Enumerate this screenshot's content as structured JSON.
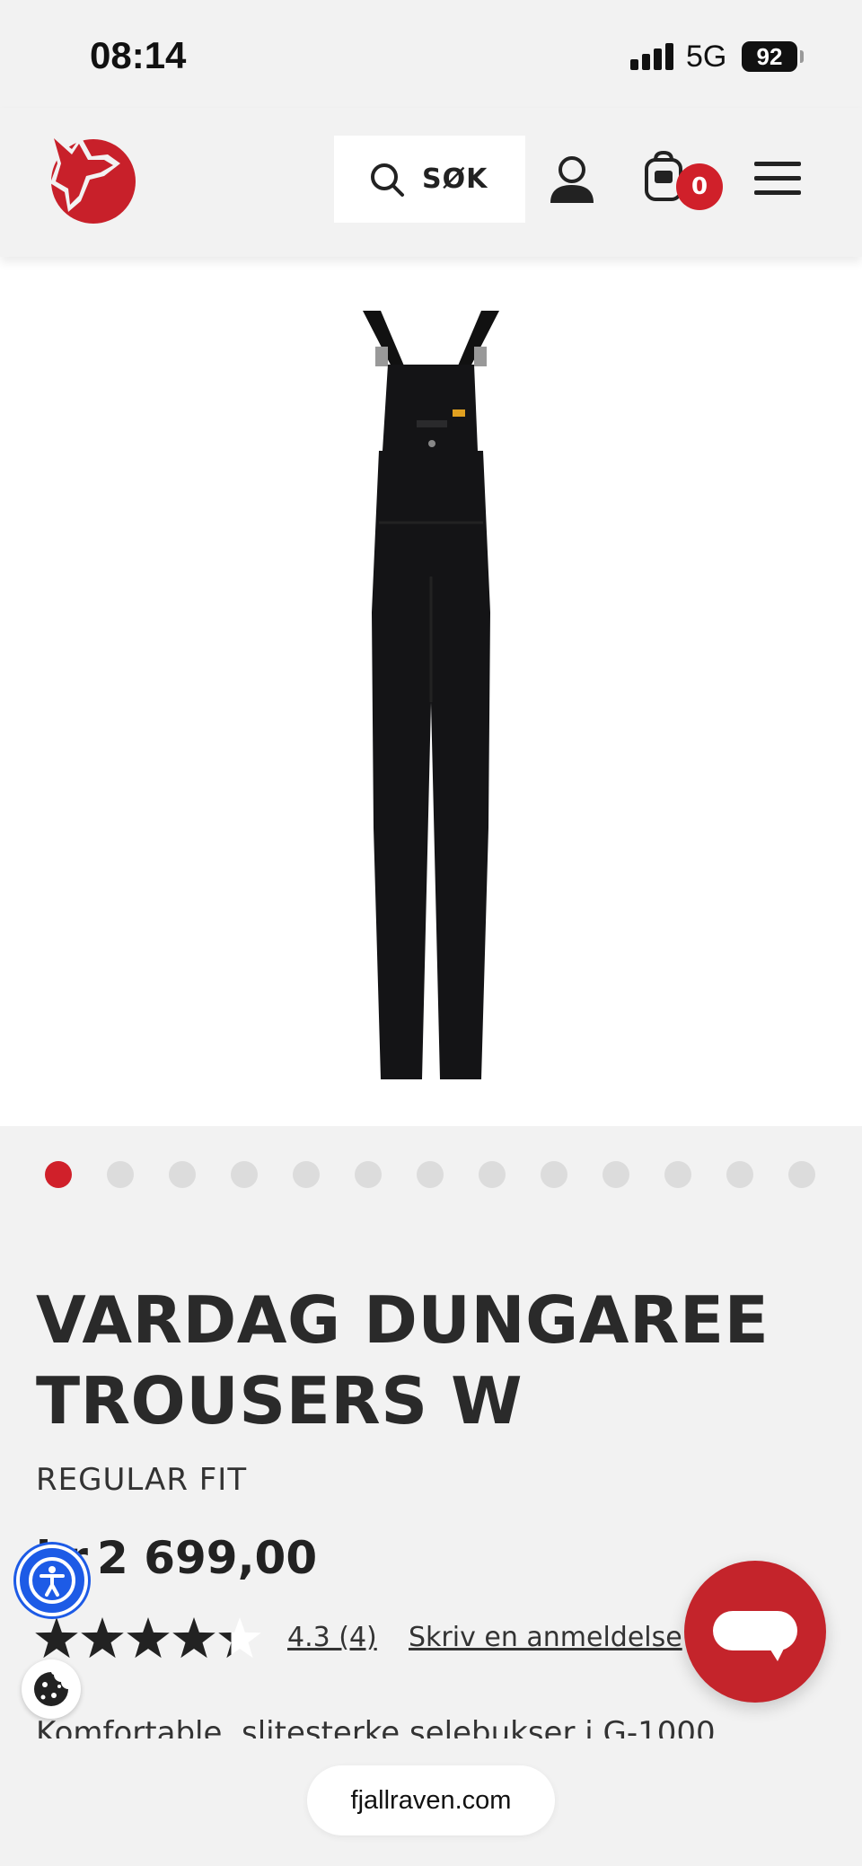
{
  "status_bar": {
    "time": "08:14",
    "network": "5G",
    "battery": "92"
  },
  "header": {
    "search_label": "SØK",
    "cart_count": "0"
  },
  "carousel": {
    "total": 13,
    "active": 1
  },
  "product": {
    "title_line1": "VARDAG DUNGAREE",
    "title_line2": "TROUSERS W",
    "fit": "REGULAR FIT",
    "price_prefix": "kr",
    "price": "2 699,00",
    "rating": 4.3,
    "rating_text": "4.3 (4)",
    "review_link": "Skriv en anmeldelse",
    "description": "Komfortable, slitesterke selebukser i G-1000"
  },
  "browser": {
    "url": "fjallraven.com"
  },
  "colors": {
    "brand_red": "#d0202a",
    "accessibility_blue": "#1d5be6",
    "background": "#f2f2f2"
  }
}
